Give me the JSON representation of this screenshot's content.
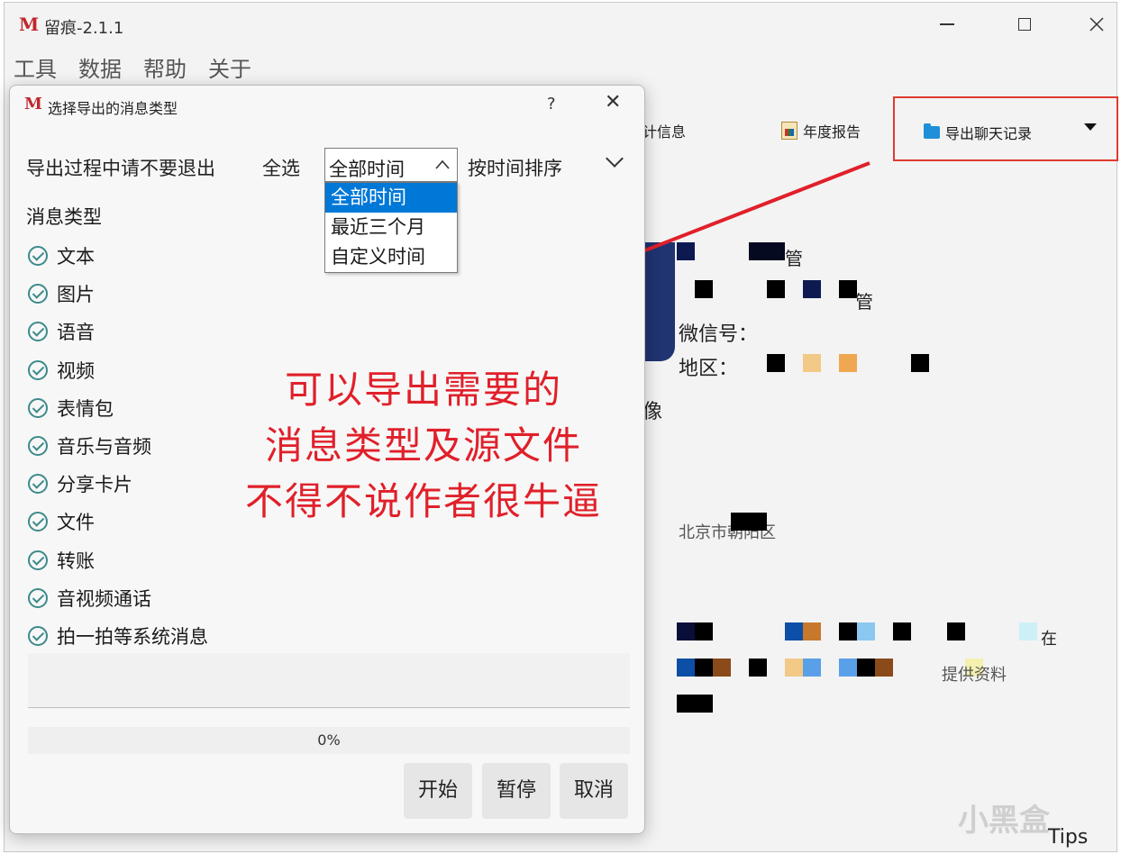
{
  "app": {
    "title": "留痕-2.1.1",
    "logo": "M"
  },
  "menu": [
    "工具",
    "数据",
    "帮助",
    "关于"
  ],
  "toolbar": {
    "info_label": "计信息",
    "annual_report_label": "年度报告",
    "export_chat_label": "导出聊天记录"
  },
  "profile": {
    "wechat_label": "微信号：",
    "region_label": "地区：",
    "name_suffix_1": "管",
    "name_suffix_2": "管",
    "partial_1": "像",
    "partial_2": "北京市朝阳区",
    "partial_3": "在",
    "partial_4": "提供资料"
  },
  "dialog": {
    "logo": "M",
    "title": "选择导出的消息类型",
    "help": "?",
    "close": "✕",
    "warning": "导出过程中请不要退出",
    "select_all": "全选",
    "time_combo_value": "全部时间",
    "time_options": [
      "全部时间",
      "最近三个月",
      "自定义时间"
    ],
    "sort_label": "按时间排序",
    "section_title": "消息类型",
    "message_types": [
      "文本",
      "图片",
      "语音",
      "视频",
      "表情包",
      "音乐与音频",
      "分享卡片",
      "文件",
      "转账",
      "音视频通话",
      "拍一拍等系统消息"
    ],
    "progress_text": "0%",
    "progress_value": 0,
    "buttons": {
      "start": "开始",
      "pause": "暂停",
      "cancel": "取消"
    }
  },
  "annotation": {
    "line1": "可以导出需要的",
    "line2": "消息类型及源文件",
    "line3": "不得不说作者很牛逼",
    "color": "#e0202a"
  },
  "watermark": "小黑盒",
  "tips": "Tips",
  "colors": {
    "accent": "#0078d7",
    "highlight_box": "#e03a2f",
    "check": "#3d8a8a",
    "logo": "#c0272d"
  }
}
